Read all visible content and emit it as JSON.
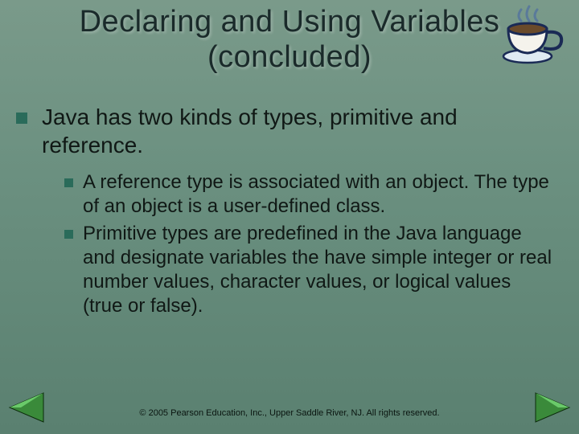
{
  "title_line1": "Declaring and Using Variables",
  "title_line2": "(concluded)",
  "main_point": "Java has two kinds of types, primitive and reference.",
  "sub_points": [
    "A reference type is associated with an object. The type of an object is a user-defined class.",
    "Primitive types are predefined in the Java language and designate variables the have simple integer or real number values, character values, or logical values (true or false)."
  ],
  "footer": "© 2005 Pearson Education, Inc., Upper Saddle River, NJ.  All rights reserved."
}
